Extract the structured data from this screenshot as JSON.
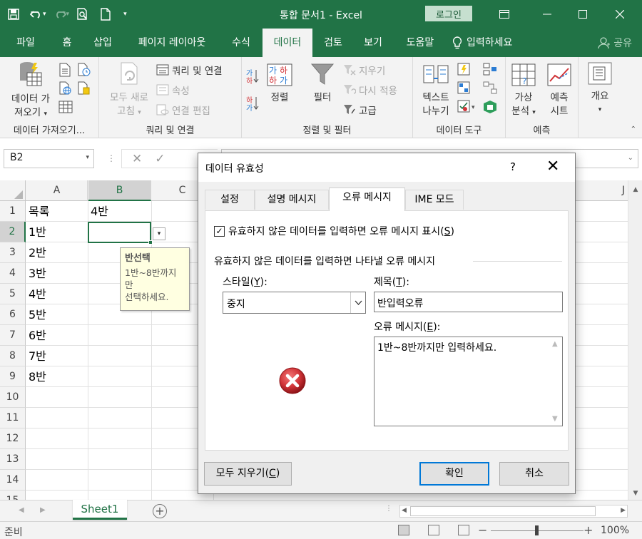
{
  "titlebar": {
    "title": "통합 문서1  -  Excel",
    "login": "로그인"
  },
  "tabs": [
    "파일",
    "홈",
    "삽입",
    "페이지 레이아웃",
    "수식",
    "데이터",
    "검토",
    "보기",
    "도움말"
  ],
  "tell_me": "입력하세요",
  "share": "공유",
  "ribbon": {
    "get_data": {
      "btn_line1": "데이터 가",
      "btn_line2": "져오기",
      "label": "데이터 가져오기..."
    },
    "queries": {
      "refresh_line1": "모두 새로",
      "refresh_line2": "고침",
      "queries_connections": "쿼리 및 연결",
      "properties": "속성",
      "edit_links": "연결 편집",
      "label": "쿼리 및 연결"
    },
    "sort_filter": {
      "sort": "정렬",
      "filter": "필터",
      "clear": "지우기",
      "reapply": "다시 적용",
      "advanced": "고급",
      "label": "정렬 및 필터"
    },
    "data_tools": {
      "text_to_columns_line1": "텍스트",
      "text_to_columns_line2": "나누기",
      "label": "데이터 도구"
    },
    "forecast": {
      "whatif_line1": "가상",
      "whatif_line2": "분석",
      "sheet_line1": "예측",
      "sheet_line2": "시트",
      "label": "예측"
    },
    "outline": {
      "label": "개요"
    }
  },
  "formula_bar": {
    "name_box": "B2",
    "content": ""
  },
  "grid": {
    "columns": [
      "A",
      "B",
      "C",
      "J"
    ],
    "rows": [
      "1",
      "2",
      "3",
      "4",
      "5",
      "6",
      "7",
      "8",
      "9",
      "10",
      "11",
      "12",
      "13",
      "14",
      "15"
    ],
    "col_a": [
      "목록",
      "1반",
      "2반",
      "3반",
      "4반",
      "5반",
      "6반",
      "7반",
      "8반"
    ],
    "b1": "4반"
  },
  "tooltip": {
    "title": "반선택",
    "body_line1": "1반~8반까지",
    "body_line2": "만",
    "body_line3": "선택하세요."
  },
  "sheet_tab": "Sheet1",
  "status": {
    "text": "준비",
    "zoom": "100%"
  },
  "dialog": {
    "title": "데이터 유효성",
    "help": "?",
    "tabs": [
      "설정",
      "설명 메시지",
      "오류 메시지",
      "IME 모드"
    ],
    "checkbox_label": "유효하지 않은 데이터를 입력하면 오류 메시지 표시",
    "checkbox_accel": "S",
    "section_label": "유효하지 않은 데이터를 입력하면 나타낼 오류 메시지",
    "style_label": "스타일",
    "style_accel": "Y",
    "style_value": "중지",
    "title_label": "제목",
    "title_accel": "T",
    "title_value": "반입력오류",
    "message_label": "오류 메시지",
    "message_accel": "E",
    "message_value": "1반~8반까지만 입력하세요.",
    "clear_all": "모두 지우기",
    "clear_all_accel": "C",
    "ok": "확인",
    "cancel": "취소"
  },
  "colors": {
    "excel_green": "#217346",
    "error_red": "#d13438",
    "default_button": "#0078d7"
  }
}
